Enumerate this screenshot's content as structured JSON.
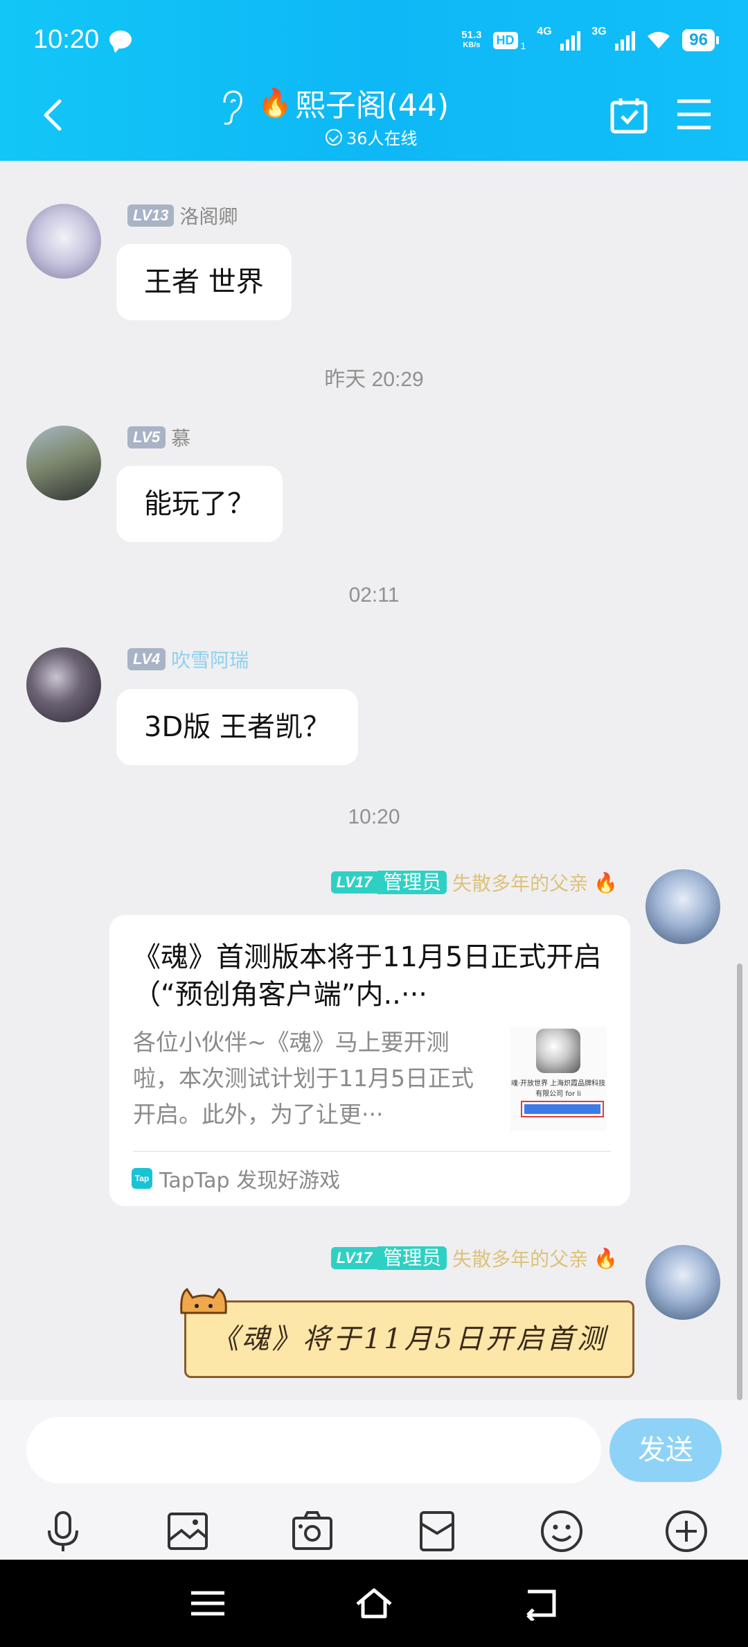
{
  "status_bar": {
    "time": "10:20",
    "net_speed_value": "51.3",
    "net_speed_unit": "KB/s",
    "hd_label": "HD",
    "hd_sub": "1",
    "signal1_label": "4G",
    "signal2_label": "3G",
    "battery": "96"
  },
  "header": {
    "title": "熙子阁(44)",
    "online_text": "36人在线",
    "icons": [
      "back-icon",
      "ear-icon",
      "flame-icon",
      "calendar-check-icon",
      "menu-icon"
    ]
  },
  "messages": [
    {
      "level": "LV13",
      "nickname": "洛阁卿",
      "text": "王者 世界"
    },
    {
      "timestamp": "昨天 20:29"
    },
    {
      "level": "LV5",
      "nickname": "慕",
      "text": "能玩了？"
    },
    {
      "timestamp": "02:11"
    },
    {
      "level": "LV4",
      "nickname": "吹雪阿瑞",
      "text": "3D版  王者凯？"
    },
    {
      "timestamp": "10:20"
    },
    {
      "level": "LV17",
      "role": "管理员",
      "nickname": "失散多年的父亲",
      "card": {
        "title": "《魂》首测版本将于11月5日正式开启（“预创角客户端”内..···",
        "description": "各位小伙伴~《魂》马上要开测啦，本次测试计划于11月5日正式开启。此外，为了让更···",
        "thumb_caption": "魂·开放世界 上海炽霞品牌科技有限公司 for li",
        "source": "TapTap 发现好游戏",
        "source_icon_text": "Tap"
      }
    },
    {
      "level": "LV17",
      "role": "管理员",
      "nickname": "失散多年的父亲",
      "sticker_text": "《魂》将于11月5日开启首测"
    }
  ],
  "input": {
    "placeholder": "",
    "send_label": "发送"
  },
  "toolbar": [
    "microphone-icon",
    "image-icon",
    "camera-icon",
    "red-packet-icon",
    "emoji-icon",
    "plus-icon"
  ],
  "colors": {
    "header": "#12c6f7",
    "level_badge": "#a9b3c6",
    "admin_badge": "#2fd0c4",
    "send_button": "#8ed3f7"
  }
}
